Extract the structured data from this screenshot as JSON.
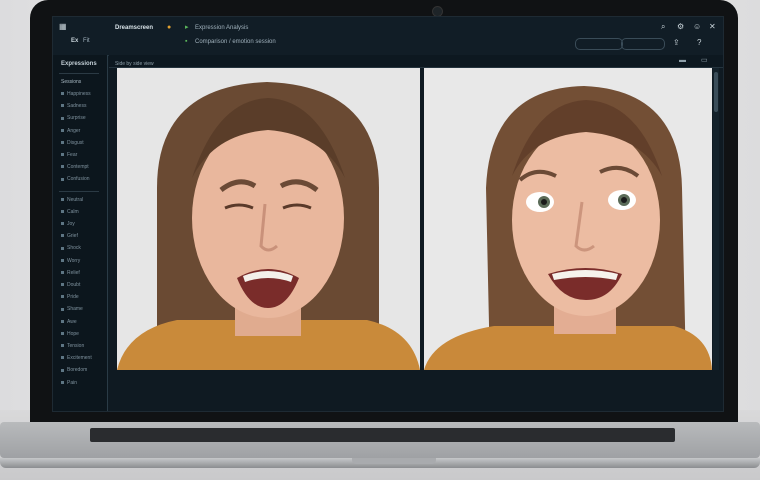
{
  "topbar": {
    "logo_label": "Ex",
    "menu_label": "Fit",
    "app_title": "Dreamscreen",
    "tab_label": "Expression Analysis",
    "path_label": "Comparison / emotion session"
  },
  "sidebar": {
    "title": "Expressions",
    "section_label": "Sessions",
    "items": [
      "Happiness",
      "Sadness",
      "Surprise",
      "Anger",
      "Disgust",
      "Fear",
      "Contempt",
      "Confusion",
      "Neutral",
      "Calm",
      "Joy",
      "Grief",
      "Shock",
      "Worry",
      "Relief",
      "Doubt",
      "Pride",
      "Shame",
      "Awe",
      "Hope",
      "Tension",
      "Excitement",
      "Boredom",
      "Pain"
    ]
  },
  "content": {
    "header_label": "Side by side view"
  },
  "colors": {
    "accent": "#3d8bd4",
    "ui_bg": "#0f1a22",
    "panel_bg": "#e4e4e4"
  },
  "icons": [
    "search-icon",
    "settings-icon",
    "user-icon",
    "share-icon",
    "help-icon",
    "close-icon"
  ]
}
